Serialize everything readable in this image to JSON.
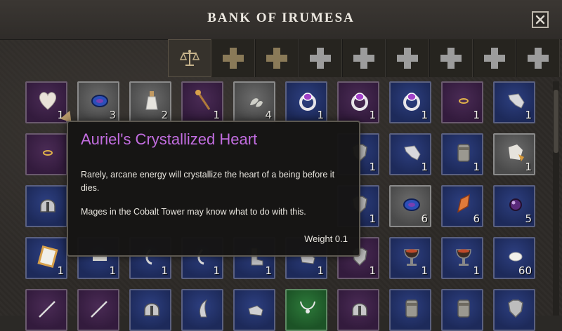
{
  "window": {
    "title": "BANK OF IRUMESA"
  },
  "tabs": [
    {
      "icon": "scale-icon"
    },
    {
      "icon": "plus-icon",
      "color": "#8a7a58"
    },
    {
      "icon": "plus-icon",
      "color": "#8a7a58"
    },
    {
      "icon": "plus-icon",
      "color": "#9c9c9c"
    },
    {
      "icon": "plus-icon",
      "color": "#9c9c9c"
    },
    {
      "icon": "plus-icon",
      "color": "#9c9c9c"
    },
    {
      "icon": "plus-icon",
      "color": "#9c9c9c"
    },
    {
      "icon": "plus-icon",
      "color": "#9c9c9c"
    },
    {
      "icon": "plus-icon",
      "color": "#9c9c9c"
    }
  ],
  "rows": [
    [
      {
        "rarity": "purple",
        "icon": "crystal-heart-icon",
        "qty": "1"
      },
      {
        "rarity": "grey",
        "icon": "blue-gem-icon",
        "qty": "3"
      },
      {
        "rarity": "grey",
        "icon": "potion-bottle-icon",
        "qty": "2"
      },
      {
        "rarity": "purple",
        "icon": "wand-icon",
        "qty": "1"
      },
      {
        "rarity": "grey",
        "icon": "leaf-icon",
        "qty": "4"
      },
      {
        "rarity": "blue",
        "icon": "ring-icon",
        "qty": "1"
      },
      {
        "rarity": "purple",
        "icon": "ring-icon",
        "qty": "1"
      },
      {
        "rarity": "blue",
        "icon": "ring-icon",
        "qty": "1"
      },
      {
        "rarity": "purple",
        "icon": "bracelet-icon",
        "qty": "1"
      },
      {
        "rarity": "blue",
        "icon": "gloves-icon",
        "qty": "1"
      }
    ],
    [
      {
        "rarity": "purple",
        "icon": "bracelet-icon",
        "qty": ""
      },
      null,
      null,
      null,
      null,
      null,
      {
        "rarity": "blue",
        "icon": "armor-icon",
        "qty": "1"
      },
      {
        "rarity": "blue",
        "icon": "gloves-icon",
        "qty": "1"
      },
      {
        "rarity": "blue",
        "icon": "bracers-icon",
        "qty": "1"
      },
      {
        "rarity": "grey",
        "icon": "bundle-icon",
        "qty": "1"
      }
    ],
    [
      {
        "rarity": "blue",
        "icon": "helmet-icon",
        "qty": ""
      },
      null,
      null,
      null,
      null,
      null,
      {
        "rarity": "blue",
        "icon": "armor-icon",
        "qty": "1"
      },
      {
        "rarity": "grey",
        "icon": "blue-gem-icon",
        "qty": "6"
      },
      {
        "rarity": "blue",
        "icon": "orange-shard-icon",
        "qty": "6"
      },
      {
        "rarity": "blue",
        "icon": "purple-orb-icon",
        "qty": "5"
      }
    ],
    [
      {
        "rarity": "blue",
        "icon": "golden-frame-icon",
        "qty": "1"
      },
      {
        "rarity": "blue",
        "icon": "scroll-icon",
        "qty": "1"
      },
      {
        "rarity": "blue",
        "icon": "hook-icon",
        "qty": "1"
      },
      {
        "rarity": "blue",
        "icon": "hook-icon",
        "qty": "1"
      },
      {
        "rarity": "blue",
        "icon": "boot-icon",
        "qty": "1"
      },
      {
        "rarity": "blue",
        "icon": "gauntlet-icon",
        "qty": "1"
      },
      {
        "rarity": "purple",
        "icon": "armor-icon",
        "qty": "1"
      },
      {
        "rarity": "blue",
        "icon": "chalice-icon",
        "qty": "1"
      },
      {
        "rarity": "blue",
        "icon": "chalice-icon",
        "qty": "1"
      },
      {
        "rarity": "blue",
        "icon": "pearl-icon",
        "qty": "60"
      }
    ],
    [
      {
        "rarity": "purple",
        "icon": "sword-icon",
        "qty": ""
      },
      {
        "rarity": "purple",
        "icon": "sword-icon",
        "qty": ""
      },
      {
        "rarity": "blue",
        "icon": "helmet-icon",
        "qty": ""
      },
      {
        "rarity": "blue",
        "icon": "wing-icon",
        "qty": ""
      },
      {
        "rarity": "blue",
        "icon": "gauntlet-icon",
        "qty": ""
      },
      {
        "rarity": "green",
        "icon": "necklace-icon",
        "qty": ""
      },
      {
        "rarity": "purple",
        "icon": "helmet-icon",
        "qty": ""
      },
      {
        "rarity": "blue",
        "icon": "bracers-icon",
        "qty": ""
      },
      {
        "rarity": "blue",
        "icon": "bracers-icon",
        "qty": ""
      },
      {
        "rarity": "blue",
        "icon": "armor-icon",
        "qty": ""
      }
    ]
  ],
  "tooltip": {
    "title": "Auriel's Crystallized Heart",
    "title_color": "#c26de0",
    "line1": "Rarely, arcane energy will crystallize the heart of a being before it dies.",
    "line2": "Mages in the Cobalt Tower may know what to do with this.",
    "weight": "Weight 0.1"
  }
}
